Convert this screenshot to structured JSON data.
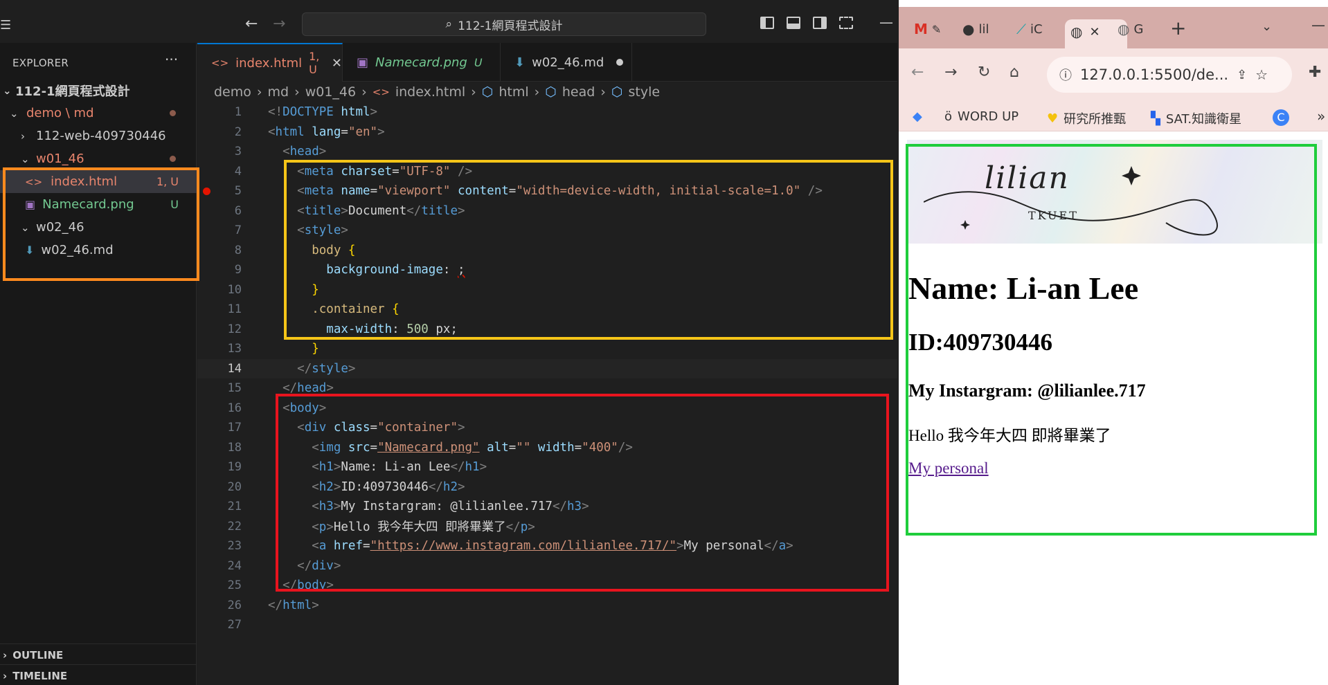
{
  "vscode": {
    "command_center": "112-1網頁程式設計",
    "explorer_title": "EXPLORER",
    "tree": {
      "root": "112-1網頁程式設計",
      "folder_demo": "demo \\ md",
      "folder_web": "112-web-409730446",
      "folder_w01": "w01_46",
      "file_index": "index.html",
      "file_index_badge": "1, U",
      "file_namecard": "Namecard.png",
      "file_namecard_badge": "U",
      "folder_w02": "w02_46",
      "file_w02md": "w02_46.md"
    },
    "outline": "OUTLINE",
    "timeline": "TIMELINE",
    "tabs": [
      {
        "label": "index.html",
        "badge": "1, U"
      },
      {
        "label": "Namecard.png",
        "badge": "U"
      },
      {
        "label": "w02_46.md"
      }
    ],
    "breadcrumb": [
      "demo",
      "md",
      "w01_46",
      "index.html",
      "html",
      "head",
      "style"
    ],
    "line_numbers": [
      "1",
      "2",
      "3",
      "4",
      "5",
      "6",
      "7",
      "8",
      "9",
      "10",
      "11",
      "12",
      "13",
      "14",
      "15",
      "16",
      "17",
      "18",
      "19",
      "20",
      "21",
      "22",
      "23",
      "24",
      "25",
      "26",
      "27"
    ],
    "code": {
      "l1_a": "<!",
      "l1_b": "DOCTYPE",
      "l1_c": " html",
      "l1_d": ">",
      "l2_tag": "html",
      "l2_attr": "lang",
      "l2_val": "\"en\"",
      "l3": "head",
      "l4_attr": "charset",
      "l4_val": "\"UTF-8\"",
      "l5_attr1": "name",
      "l5_val1": "\"viewport\"",
      "l5_attr2": "content",
      "l5_val2": "\"width=device-width, initial-scale=1.0\"",
      "l6_text": "Document",
      "l7": "style",
      "l8_sel": "body",
      "l9_prop": "background-image",
      "l11_sel": ".container",
      "l12_prop": "max-width",
      "l12_val": "500",
      "l12_unit": " px",
      "l16": "body",
      "l17_attr": "class",
      "l17_val": "\"container\"",
      "l18_attr1": "src",
      "l18_val1": "\"Namecard.png\"",
      "l18_attr2": "alt",
      "l18_val2": "\"\"",
      "l18_attr3": "width",
      "l18_val3": "\"400\"",
      "l19_text": "Name: Li-an Lee",
      "l20_text": "ID:409730446",
      "l21_text": "My Instargram: @lilianlee.717",
      "l22_text": "Hello 我今年大四 即將畢業了",
      "l23_attr": "href",
      "l23_val": "\"https://www.instagram.com/lilianlee.717/\"",
      "l23_text": "My personal"
    }
  },
  "browser": {
    "tabs": [
      "lil",
      "iC",
      "G"
    ],
    "url": "127.0.0.1:5500/de...",
    "bookmarks": [
      "WORD UP",
      "研究所推甄",
      "SAT.知識衛星"
    ],
    "page": {
      "namecard_name": "lilian",
      "namecard_sub": "TKUET",
      "h1": "Name: Li-an Lee",
      "h2": "ID:409730446",
      "h3": "My Instargram: @lilianlee.717",
      "p": "Hello 我今年大四 即將畢業了",
      "link": "My personal"
    }
  },
  "annotations": {
    "orange": "#ff8a1e",
    "yellow": "#f5c518",
    "red": "#e8141e",
    "green": "#1fcd3c"
  }
}
